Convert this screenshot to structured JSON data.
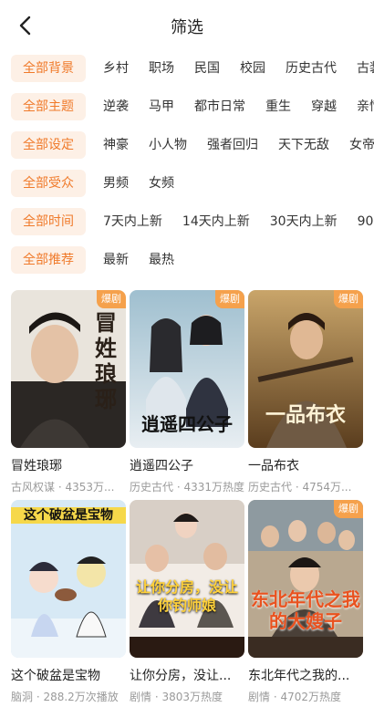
{
  "header": {
    "title": "筛选",
    "back_icon": "chevron-left-icon"
  },
  "filters": [
    {
      "chip": "全部背景",
      "options": [
        "乡村",
        "职场",
        "民国",
        "校园",
        "历史古代",
        "古装"
      ]
    },
    {
      "chip": "全部主题",
      "options": [
        "逆袭",
        "马甲",
        "都市日常",
        "重生",
        "穿越",
        "亲情"
      ]
    },
    {
      "chip": "全部设定",
      "options": [
        "神豪",
        "小人物",
        "强者回归",
        "天下无敌",
        "女帝"
      ]
    },
    {
      "chip": "全部受众",
      "options": [
        "男频",
        "女频"
      ]
    },
    {
      "chip": "全部时间",
      "options": [
        "7天内上新",
        "14天内上新",
        "30天内上新",
        "90"
      ]
    },
    {
      "chip": "全部推荐",
      "options": [
        "最新",
        "最热"
      ]
    }
  ],
  "cards": [
    {
      "title": "冒姓琅琊",
      "meta": "古风权谋 · 4353万...",
      "badge": "爆剧",
      "poster_text": "冒姓琅琊",
      "poster_color": "#3a3530"
    },
    {
      "title": "逍遥四公子",
      "meta": "历史古代 · 4331万热度",
      "badge": "爆剧",
      "poster_text": "逍遥四公子",
      "poster_color": "#5d7a85"
    },
    {
      "title": "一品布衣",
      "meta": "历史古代 · 4754万...",
      "badge": "爆剧",
      "poster_text": "一品布衣",
      "poster_color": "#7a5a2e"
    },
    {
      "title": "这个破盆是宝物",
      "meta": "脑洞 · 288.2万次播放",
      "badge": "",
      "poster_text": "这个破盆是宝物",
      "poster_color": "#cfe4f2"
    },
    {
      "title": "让你分房，没让...",
      "meta": "剧情 · 3803万热度",
      "badge": "",
      "poster_text": "让你分房，没让你钓师娘",
      "poster_color": "#b04a3a"
    },
    {
      "title": "东北年代之我的...",
      "meta": "剧情 · 4702万热度",
      "badge": "爆剧",
      "poster_text": "东北年代之我的大嫂子",
      "poster_color": "#8a7055"
    }
  ],
  "colors": {
    "accent": "#f07a2a",
    "chip_bg": "#fdf0e6",
    "badge": "#f5a14c"
  }
}
